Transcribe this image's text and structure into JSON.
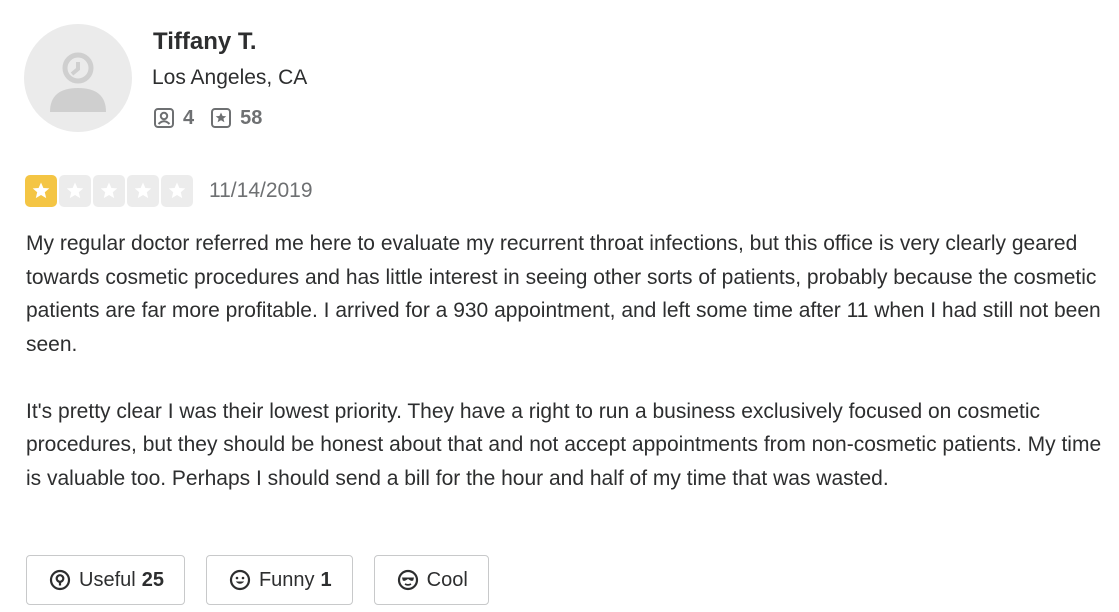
{
  "user": {
    "name": "Tiffany T.",
    "location": "Los Angeles, CA",
    "friends_count": "4",
    "reviews_count": "58"
  },
  "review": {
    "rating": 1,
    "max_rating": 5,
    "date": "11/14/2019",
    "paragraphs": [
      "My regular doctor referred me here to evaluate my recurrent throat infections, but this office is very clearly geared towards cosmetic procedures and has little interest in seeing other sorts of patients, probably because the cosmetic patients are far more profitable. I arrived for a 930 appointment, and left some time after 11 when I had still not been seen.",
      "It's pretty clear I was their lowest priority. They have a right to run a business exclusively focused on cosmetic procedures, but they should be honest about that and not accept appointments from non-cosmetic patients. My time is valuable too. Perhaps I should send a bill for the hour and half of my time that was wasted."
    ]
  },
  "actions": {
    "useful": {
      "label": "Useful",
      "count": "25",
      "icon": "lightbulb-icon"
    },
    "funny": {
      "label": "Funny",
      "count": "1",
      "icon": "smile-icon"
    },
    "cool": {
      "label": "Cool",
      "count": "",
      "icon": "sunglasses-icon"
    }
  },
  "colors": {
    "star_filled": "#f4c544",
    "star_empty": "#ececec",
    "text": "#2d2e2f",
    "muted": "#6e7072"
  }
}
